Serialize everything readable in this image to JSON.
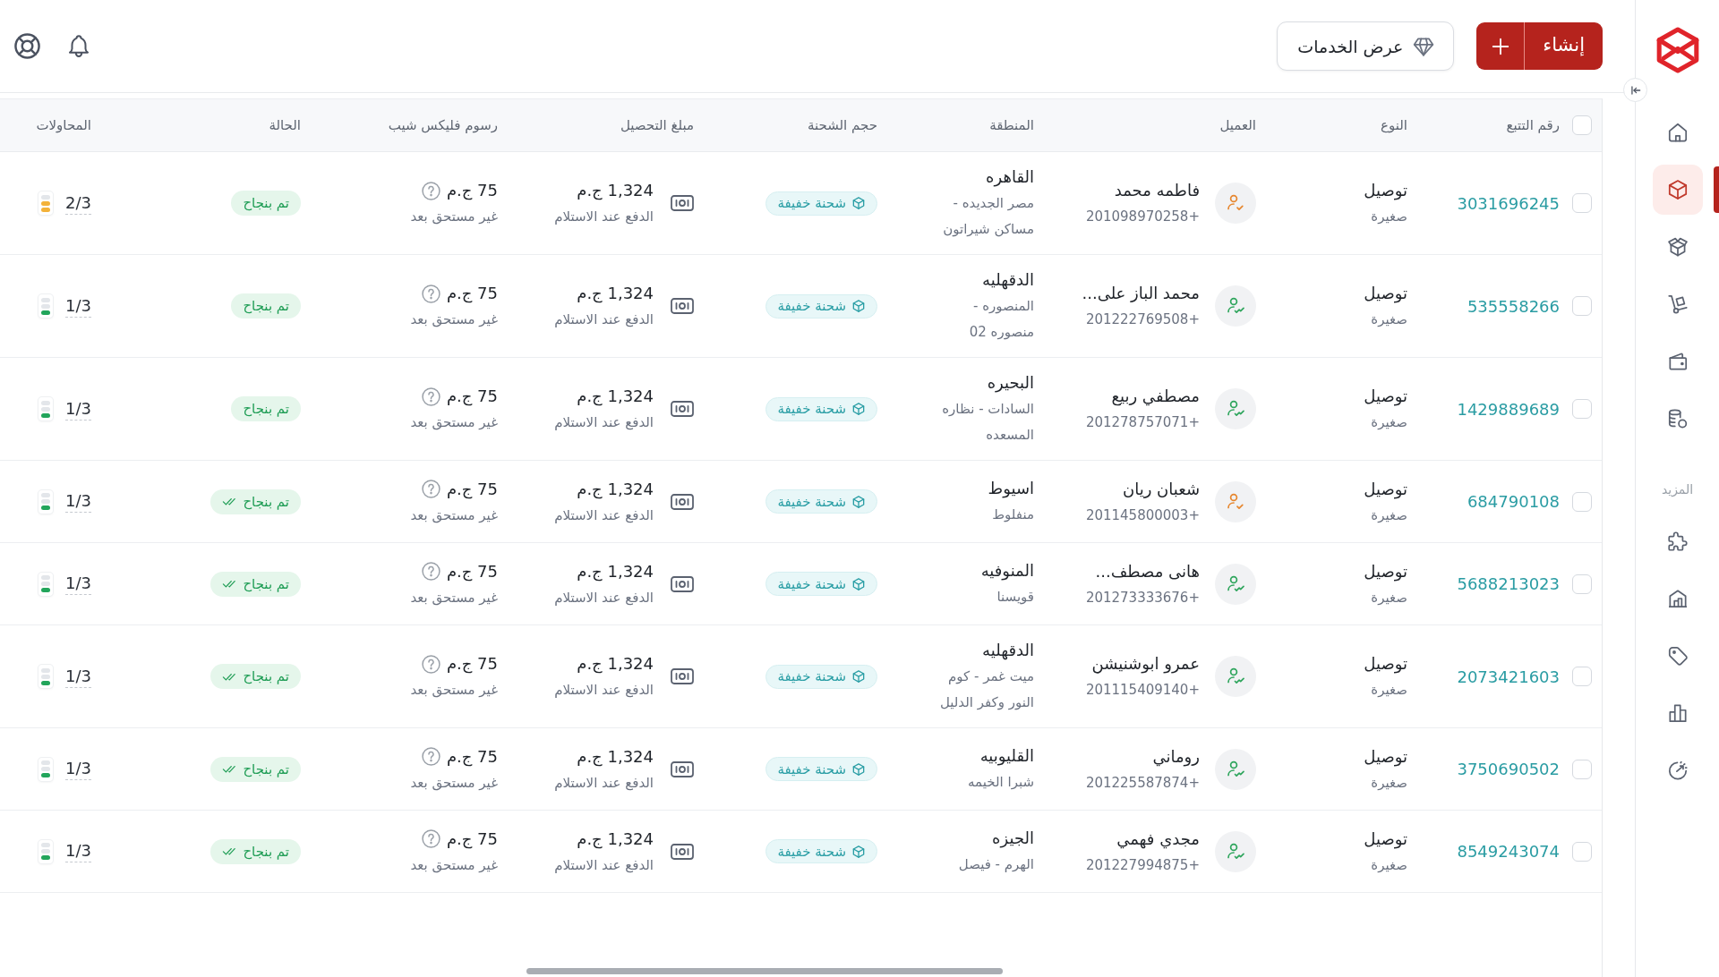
{
  "sidebar": {
    "items": [
      {
        "selected": false
      },
      {
        "selected": true
      },
      {
        "selected": false
      },
      {
        "selected": false
      },
      {
        "selected": false
      },
      {
        "selected": false
      }
    ],
    "section_label": "المزيد",
    "more_items": [
      {
        "selected": false
      },
      {
        "selected": false
      },
      {
        "selected": false
      },
      {
        "selected": false
      },
      {
        "selected": false
      }
    ]
  },
  "header": {
    "create_button": {
      "label": "إنشاء"
    },
    "services_button": {
      "label": "عرض الخدمات"
    }
  },
  "table": {
    "select_all": {
      "checked": false
    },
    "columns": [
      "رقم التتبع",
      "النوع",
      "العميل",
      "المنطقة",
      "حجم الشحنة",
      "مبلغ التحصيل",
      "رسوم فليكس شيب",
      "الحالة",
      "المحاولات"
    ],
    "rows": [
      {
        "selected": false,
        "tracking_number": "3031696245",
        "type": "توصيل",
        "size_class": "صغيرة",
        "customer": {
          "name": "فاطمه محمد",
          "phone": "+201098970258",
          "verified": false
        },
        "region": {
          "governorate": "القاهره",
          "area": "مصر الجديده -\nمساكن شيراتون"
        },
        "shipment_size": "شحنة خفيفة",
        "collection": {
          "amount": "1,324 ج.م",
          "method": "الدفع عند الاستلام"
        },
        "fee": {
          "amount": "75 ج.م",
          "note": "غير مستحق بعد"
        },
        "status": {
          "label": "تم بنجاح",
          "checkmark": false
        },
        "attempts": {
          "text": "2/3",
          "level": 0.667
        }
      },
      {
        "selected": false,
        "tracking_number": "535558266",
        "type": "توصيل",
        "size_class": "صغيرة",
        "customer": {
          "name": "محمد الباز على...",
          "phone": "+201222769508",
          "verified": true
        },
        "region": {
          "governorate": "الدقهليه",
          "area": "المنصوره -\nمنصوره 02"
        },
        "shipment_size": "شحنة خفيفة",
        "collection": {
          "amount": "1,324 ج.م",
          "method": "الدفع عند الاستلام"
        },
        "fee": {
          "amount": "75 ج.م",
          "note": "غير مستحق بعد"
        },
        "status": {
          "label": "تم بنجاح",
          "checkmark": false
        },
        "attempts": {
          "text": "1/3",
          "level": 0.333
        }
      },
      {
        "selected": false,
        "tracking_number": "1429889689",
        "type": "توصيل",
        "size_class": "صغيرة",
        "customer": {
          "name": "مصطفي ربيع",
          "phone": "+201278757071",
          "verified": true
        },
        "region": {
          "governorate": "البحيره",
          "area": "السادات - نظاره\nالمسعده"
        },
        "shipment_size": "شحنة خفيفة",
        "collection": {
          "amount": "1,324 ج.م",
          "method": "الدفع عند الاستلام"
        },
        "fee": {
          "amount": "75 ج.م",
          "note": "غير مستحق بعد"
        },
        "status": {
          "label": "تم بنجاح",
          "checkmark": false
        },
        "attempts": {
          "text": "1/3",
          "level": 0.333
        }
      },
      {
        "selected": false,
        "tracking_number": "684790108",
        "type": "توصيل",
        "size_class": "صغيرة",
        "customer": {
          "name": "شعبان ريان",
          "phone": "+201145800003",
          "verified": false
        },
        "region": {
          "governorate": "اسيوط",
          "area": "منفلوط"
        },
        "shipment_size": "شحنة خفيفة",
        "collection": {
          "amount": "1,324 ج.م",
          "method": "الدفع عند الاستلام"
        },
        "fee": {
          "amount": "75 ج.م",
          "note": "غير مستحق بعد"
        },
        "status": {
          "label": "تم بنجاح",
          "checkmark": true
        },
        "attempts": {
          "text": "1/3",
          "level": 0.333
        }
      },
      {
        "selected": false,
        "tracking_number": "5688213023",
        "type": "توصيل",
        "size_class": "صغيرة",
        "customer": {
          "name": "هانى مصطف...",
          "phone": "+201273333676",
          "verified": true
        },
        "region": {
          "governorate": "المنوفيه",
          "area": "قويسنا"
        },
        "shipment_size": "شحنة خفيفة",
        "collection": {
          "amount": "1,324 ج.م",
          "method": "الدفع عند الاستلام"
        },
        "fee": {
          "amount": "75 ج.م",
          "note": "غير مستحق بعد"
        },
        "status": {
          "label": "تم بنجاح",
          "checkmark": true
        },
        "attempts": {
          "text": "1/3",
          "level": 0.333
        }
      },
      {
        "selected": false,
        "tracking_number": "2073421603",
        "type": "توصيل",
        "size_class": "صغيرة",
        "customer": {
          "name": "عمرو ابوشنيشن",
          "phone": "+201115409140",
          "verified": true
        },
        "region": {
          "governorate": "الدقهليه",
          "area": "ميت غمر - كوم\nالنور وكفر الدليل"
        },
        "shipment_size": "شحنة خفيفة",
        "collection": {
          "amount": "1,324 ج.م",
          "method": "الدفع عند الاستلام"
        },
        "fee": {
          "amount": "75 ج.م",
          "note": "غير مستحق بعد"
        },
        "status": {
          "label": "تم بنجاح",
          "checkmark": true
        },
        "attempts": {
          "text": "1/3",
          "level": 0.333
        }
      },
      {
        "selected": false,
        "tracking_number": "3750690502",
        "type": "توصيل",
        "size_class": "صغيرة",
        "customer": {
          "name": "روماني",
          "phone": "+201225587874",
          "verified": true
        },
        "region": {
          "governorate": "القليوبيه",
          "area": "شبرا الخيمه"
        },
        "shipment_size": "شحنة خفيفة",
        "collection": {
          "amount": "1,324 ج.م",
          "method": "الدفع عند الاستلام"
        },
        "fee": {
          "amount": "75 ج.م",
          "note": "غير مستحق بعد"
        },
        "status": {
          "label": "تم بنجاح",
          "checkmark": true
        },
        "attempts": {
          "text": "1/3",
          "level": 0.333
        }
      },
      {
        "selected": false,
        "tracking_number": "8549243074",
        "type": "توصيل",
        "size_class": "صغيرة",
        "customer": {
          "name": "مجدي فهمي",
          "phone": "+201227994875",
          "verified": true
        },
        "region": {
          "governorate": "الجيزه",
          "area": "الهرم - فيصل"
        },
        "shipment_size": "شحنة خفيفة",
        "collection": {
          "amount": "1,324 ج.م",
          "method": "الدفع عند الاستلام"
        },
        "fee": {
          "amount": "75 ج.م",
          "note": "غير مستحق بعد"
        },
        "status": {
          "label": "تم بنجاح",
          "checkmark": true
        },
        "attempts": {
          "text": "1/3",
          "level": 0.333
        }
      }
    ]
  }
}
